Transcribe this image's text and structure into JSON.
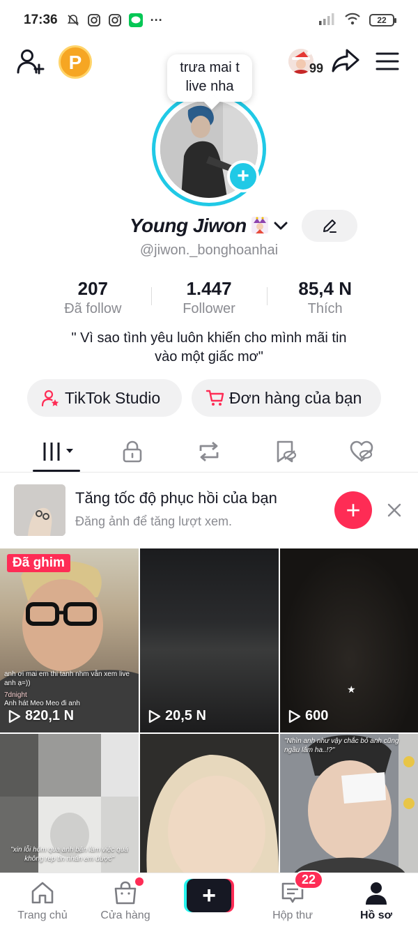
{
  "status_bar": {
    "time": "17:36",
    "battery": "22"
  },
  "top_bar": {
    "coin_letter": "P",
    "friend_count": "99"
  },
  "note_bubble": {
    "line1": "trưa mai t",
    "line2": "live nha"
  },
  "profile": {
    "name": "Young Jiwon",
    "handle": "@jiwon._bonghoanhai",
    "bio_line1": "\" Vì sao tình yêu luôn khiến cho mình mãi tin",
    "bio_line2": "vào một giấc mơ\""
  },
  "stats": [
    {
      "value": "207",
      "label": "Đã follow"
    },
    {
      "value": "1.447",
      "label": "Follower"
    },
    {
      "value": "85,4 N",
      "label": "Thích"
    }
  ],
  "actions": {
    "studio_label": "TikTok Studio",
    "orders_label": "Đơn hàng của bạn"
  },
  "tabs": [
    "videos-grid",
    "private",
    "reposts",
    "favorites",
    "liked"
  ],
  "boost_card": {
    "title": "Tăng tốc độ phục hồi của bạn",
    "subtitle": "Đăng ảnh để tăng lượt xem."
  },
  "videos": [
    {
      "pinned_label": "Đã ghim",
      "views": "820,1 N",
      "caption1": "anh ơi mai em thi tanh nhm vẫn xem live anh ạ=))",
      "caption2": "7dnight",
      "caption3": "Anh hát Meo Meo đi anh"
    },
    {
      "views": "20,5 N"
    },
    {
      "views": "600"
    },
    {
      "caption": "\"xin lỗi hôm qua anh bận làm việc quá không rep tin nhắn em được\""
    },
    {},
    {
      "caption": "\"Nhìn anh như vậy chắc bỏ anh cũng ngầu lắm ha..!?\""
    }
  ],
  "bottom_nav": {
    "home": "Trang chủ",
    "shop": "Cửa hàng",
    "inbox": "Hộp thư",
    "inbox_badge": "22",
    "profile": "Hồ sơ"
  },
  "colors": {
    "accent": "#fe2c55",
    "ring": "#20c9e6",
    "text": "#161823",
    "muted": "#8a8b91"
  }
}
